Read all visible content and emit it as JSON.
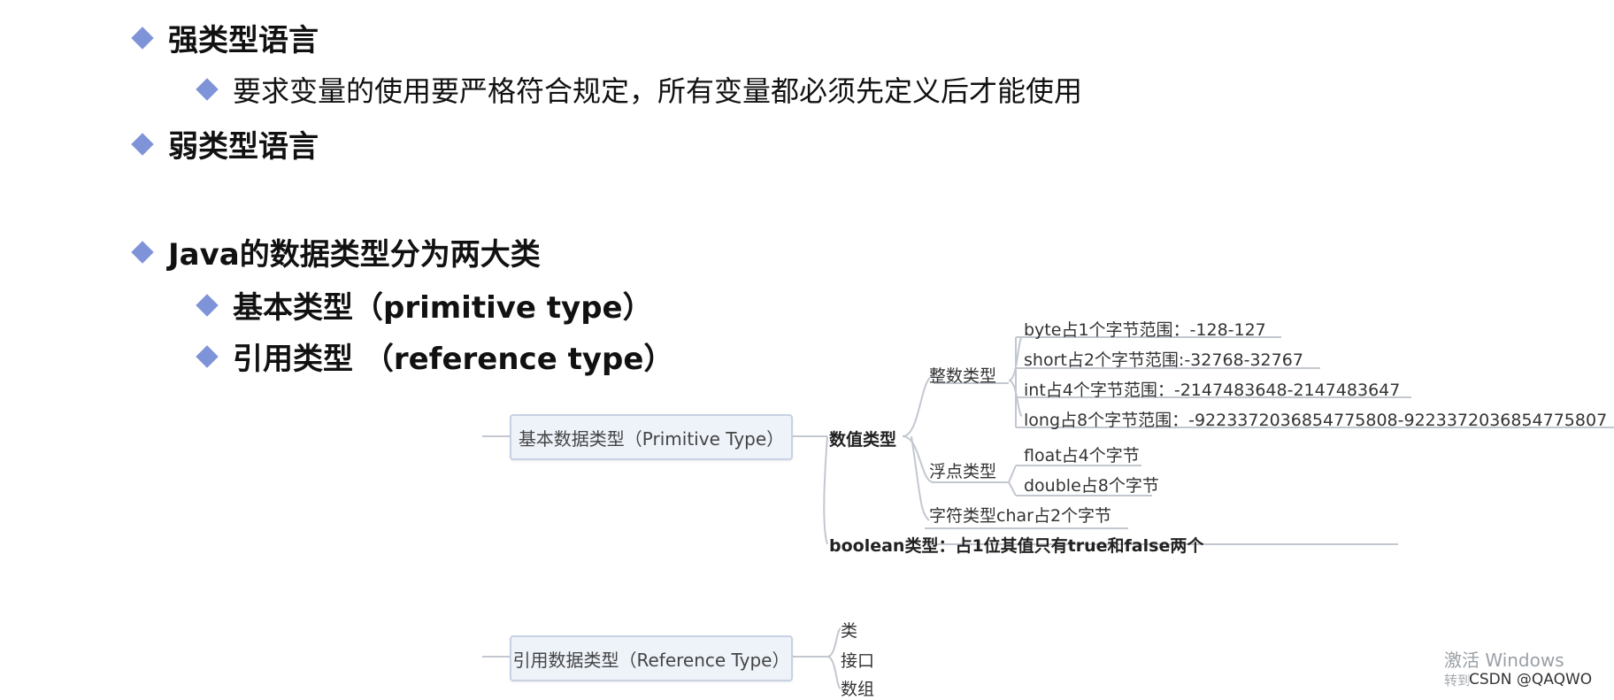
{
  "bullets": {
    "strong": "强类型语言",
    "strong_sub": "要求变量的使用要严格符合规定，所有变量都必须先定义后才能使用",
    "weak": "弱类型语言",
    "java": "Java的数据类型分为两大类",
    "primitive": "基本类型（primitive type）",
    "reference": "引用类型 （reference type）"
  },
  "mindmap": {
    "primitive_root": "基本数据类型（Primitive Type）",
    "numeric": "数值类型",
    "integer": "整数类型",
    "byte": "byte占1个字节范围：-128-127",
    "short": "short占2个字节范围:-32768-32767",
    "int": "int占4个字节范围：-2147483648-2147483647",
    "long": "long占8个字节范围：-9223372036854775808-9223372036854775807",
    "float_type": "浮点类型",
    "float": "float占4个字节",
    "double": "double占8个字节",
    "char": "字符类型char占2个字节",
    "boolean": "boolean类型：占1位其值只有true和false两个",
    "reference_root": "引用数据类型（Reference Type）",
    "class": "类",
    "interface": "接口",
    "array": "数组"
  },
  "watermark": {
    "activate": "激活 Windows",
    "goto": "转到",
    "csdn": "CSDN @QAQWO"
  }
}
